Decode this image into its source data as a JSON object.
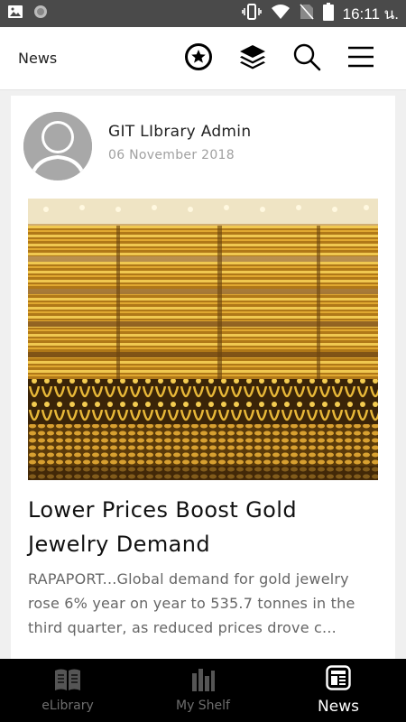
{
  "status_bar": {
    "time": "16:11 น."
  },
  "app_bar": {
    "title": "News"
  },
  "post": {
    "author": "GIT LIbrary Admin",
    "date": "06 November 2018",
    "headline": "Lower Prices Boost Gold Jewelry Demand",
    "excerpt": "RAPAPORT...Global demand for gold jewelry rose 6% year on year to 535.7 tonnes in the third quarter, as reduced prices drove c..."
  },
  "bottom_nav": [
    {
      "label": "eLibrary",
      "icon": "book-icon",
      "active": false
    },
    {
      "label": "My Shelf",
      "icon": "shelf-icon",
      "active": false
    },
    {
      "label": "News",
      "icon": "news-icon",
      "active": true
    }
  ],
  "colors": {
    "status_bar": "#4a4a4a",
    "nav_bg": "#000000",
    "nav_inactive": "#6e6e6e",
    "gold": "#c8962a"
  }
}
